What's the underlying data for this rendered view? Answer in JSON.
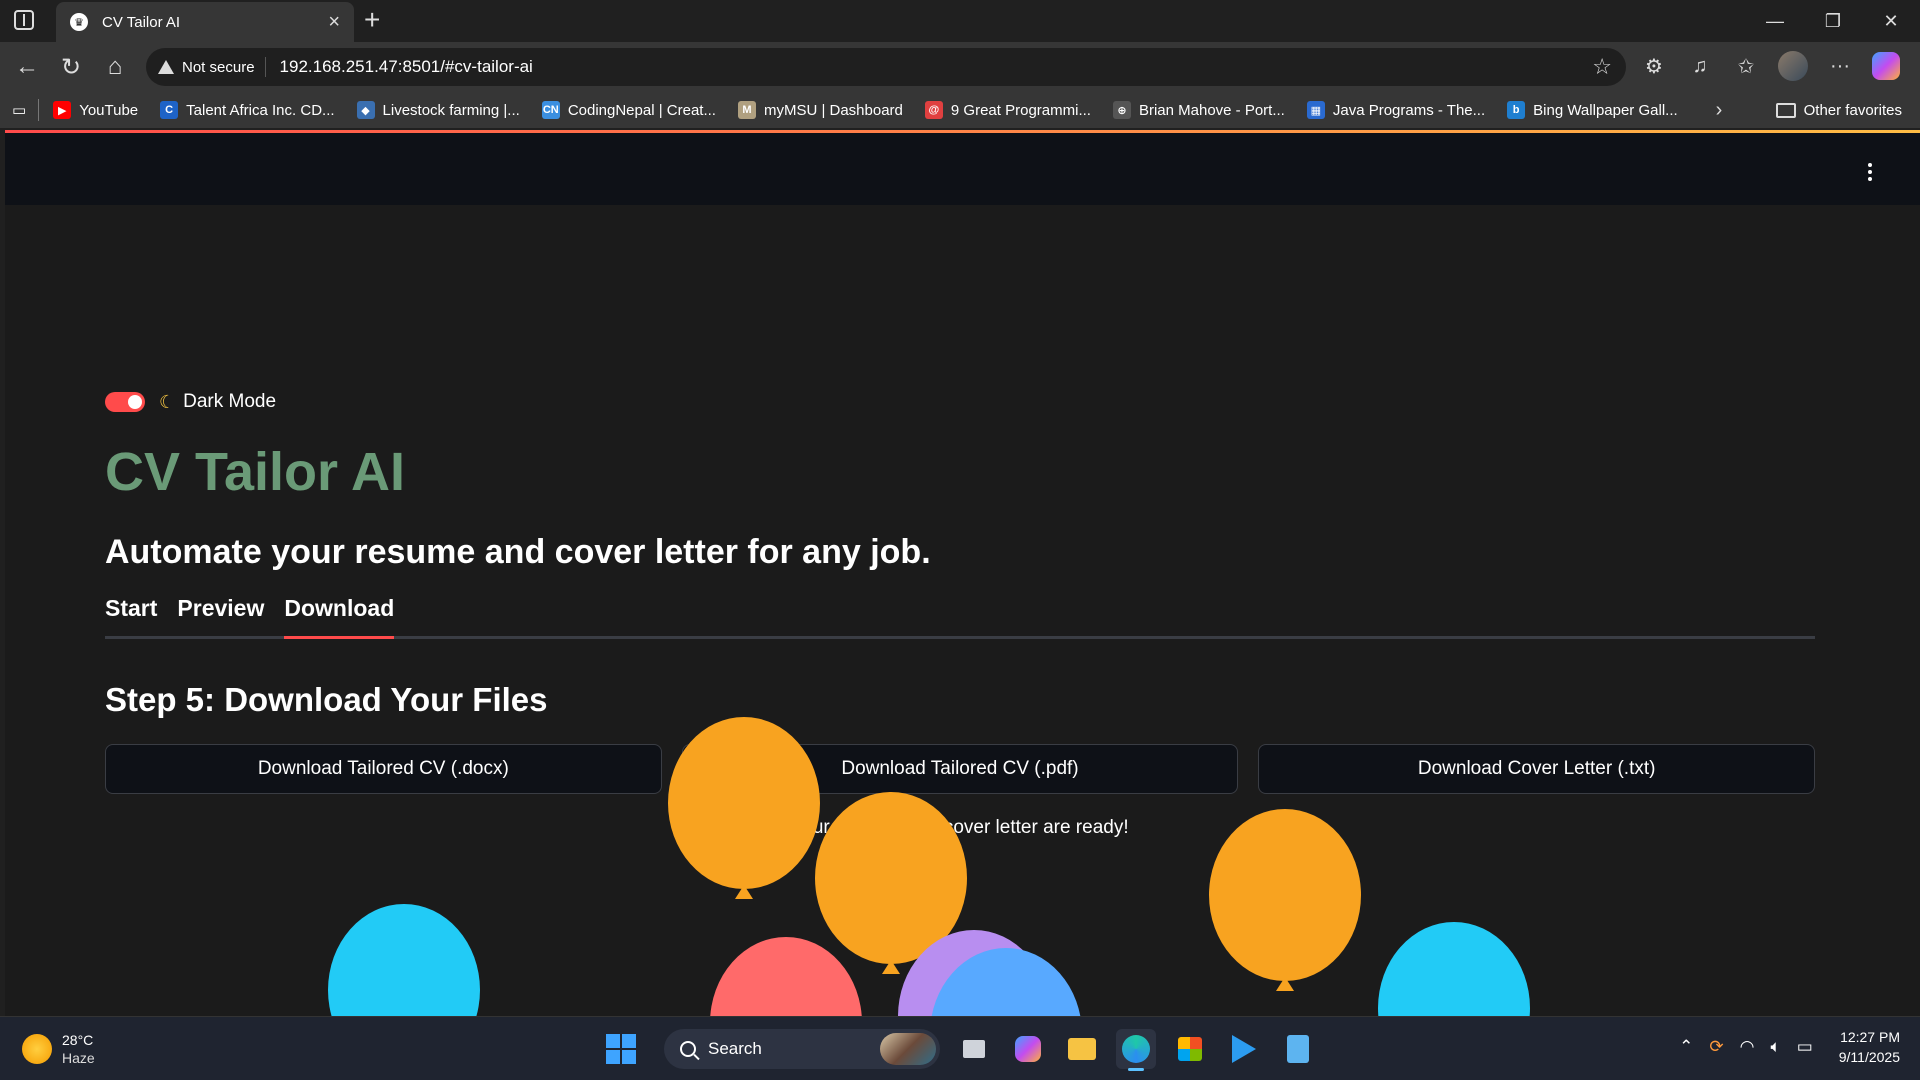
{
  "browser": {
    "tab_title": "CV Tailor AI",
    "security_label": "Not secure",
    "url": "192.168.251.47:8501/#cv-tailor-ai",
    "bookmarks": [
      {
        "label": "YouTube",
        "color": "#ff0000",
        "glyph": "▶"
      },
      {
        "label": "Talent Africa Inc. CD...",
        "color": "#1e63c7",
        "glyph": "C"
      },
      {
        "label": "Livestock farming |...",
        "color": "#3a6fb0",
        "glyph": "◆"
      },
      {
        "label": "CodingNepal | Creat...",
        "color": "#3b8fe0",
        "glyph": "CN"
      },
      {
        "label": "myMSU | Dashboard",
        "color": "#b0a080",
        "glyph": "M"
      },
      {
        "label": "9 Great Programmi...",
        "color": "#e04040",
        "glyph": "@"
      },
      {
        "label": "Brian Mahove - Port...",
        "color": "#555555",
        "glyph": "⊕"
      },
      {
        "label": "Java Programs - The...",
        "color": "#2a6ad0",
        "glyph": "▦"
      },
      {
        "label": "Bing Wallpaper Gall...",
        "color": "#1f7fd0",
        "glyph": "b"
      }
    ],
    "other_favorites": "Other favorites"
  },
  "app": {
    "dark_mode_label": "Dark Mode",
    "dark_mode_on": true,
    "title": "CV Tailor AI",
    "subtitle": "Automate your resume and cover letter for any job.",
    "tabs": [
      "Start",
      "Preview",
      "Download"
    ],
    "active_tab": "Download",
    "step_title": "Step 5: Download Your Files",
    "buttons": {
      "docx": "Download Tailored CV (.docx)",
      "pdf": "Download Tailored CV (.pdf)",
      "txt": "Download Cover Letter (.txt)"
    },
    "ready_message": "Your new CV and cover letter are ready!",
    "accent_color": "#ff4b4b",
    "title_color": "#6a9a77"
  },
  "taskbar": {
    "temperature": "28°C",
    "weather": "Haze",
    "search_label": "Search",
    "time": "12:27 PM",
    "date": "9/11/2025"
  }
}
